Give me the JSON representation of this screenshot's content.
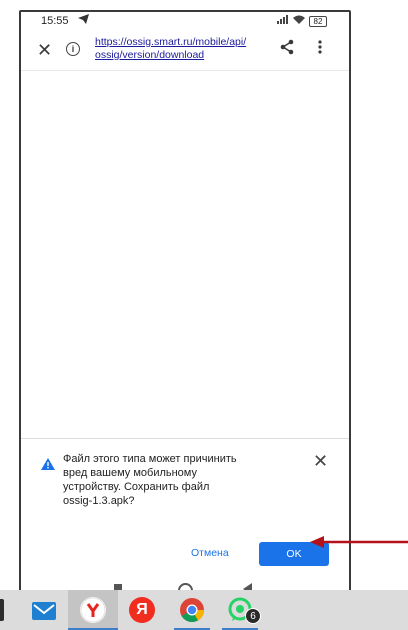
{
  "status_bar": {
    "time": "15:55",
    "battery": "82",
    "icons": [
      "telegram-icon",
      "signal-icon",
      "wifi-icon",
      "battery-icon"
    ]
  },
  "browser": {
    "url_line1": "https://ossig.smart.ru/mobile/api/",
    "url_line2": "ossig/version/download"
  },
  "download_dialog": {
    "message_line1": "Файл этого типа может причинить",
    "message_line2": "вред вашему мобильному",
    "message_line3": "устройству. Сохранить файл",
    "message_line4": "ossig-1.3.apk?",
    "cancel_label": "Отмена",
    "ok_label": "OK"
  },
  "taskbar": {
    "apps": [
      "mail-icon",
      "yandex-browser-icon",
      "yandex-icon",
      "chrome-icon",
      "whatsapp-icon"
    ],
    "yandex_letter": "Я",
    "whatsapp_badge": "6"
  },
  "colors": {
    "accent": "#1a73e8",
    "warning": "#1a73e8",
    "arrow": "#b3121b",
    "taskbar": "#dcdcdc"
  }
}
